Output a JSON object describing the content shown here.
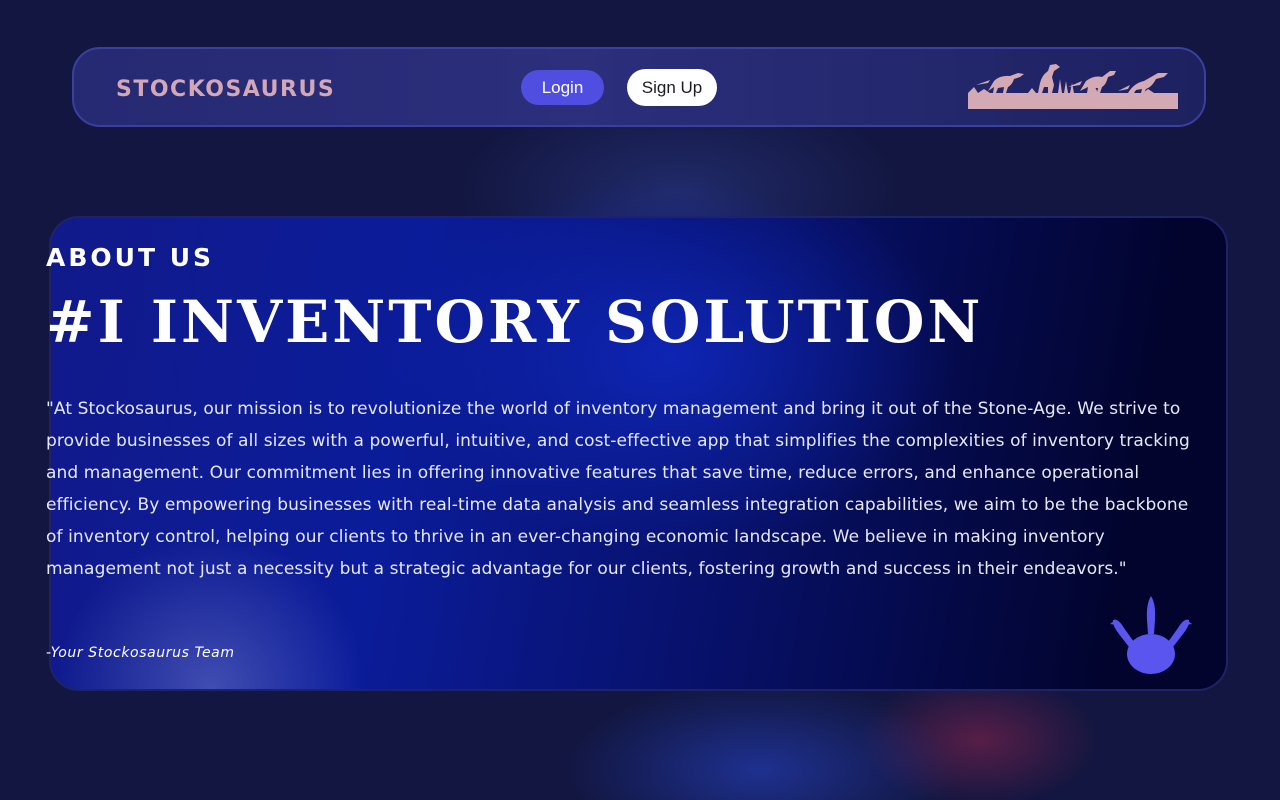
{
  "header": {
    "brand": "STOCKOSAURUS",
    "login_label": "Login",
    "signup_label": "Sign Up",
    "banner_icon": "dinosaur-silhouettes-icon"
  },
  "about": {
    "eyebrow": "ABOUT US",
    "headline": "#I INVENTORY SOLUTION",
    "mission": "\"At Stockosaurus, our mission is to revolutionize the world of inventory management and bring it out of the Stone-Age. We strive to provide businesses of all sizes with a powerful, intuitive, and cost-effective app that simplifies the complexities of inventory tracking and management. Our commitment lies in offering innovative features that save time, reduce errors, and enhance operational efficiency. By empowering businesses with real-time data analysis and seamless integration capabilities, we aim to be the backbone of inventory control, helping our clients to thrive in an ever-changing economic landscape. We believe in making inventory management not just a necessity but a strategic advantage for our clients, fostering growth and success in their endeavors.\"",
    "signature": "-Your Stockosaurus Team",
    "footprint_icon": "dino-footprint-icon"
  },
  "colors": {
    "brand": "#d4a7b6",
    "login_button": "#4f4ee0",
    "signup_button": "#ffffff",
    "footprint": "#5b55f0",
    "background": "#121640"
  }
}
